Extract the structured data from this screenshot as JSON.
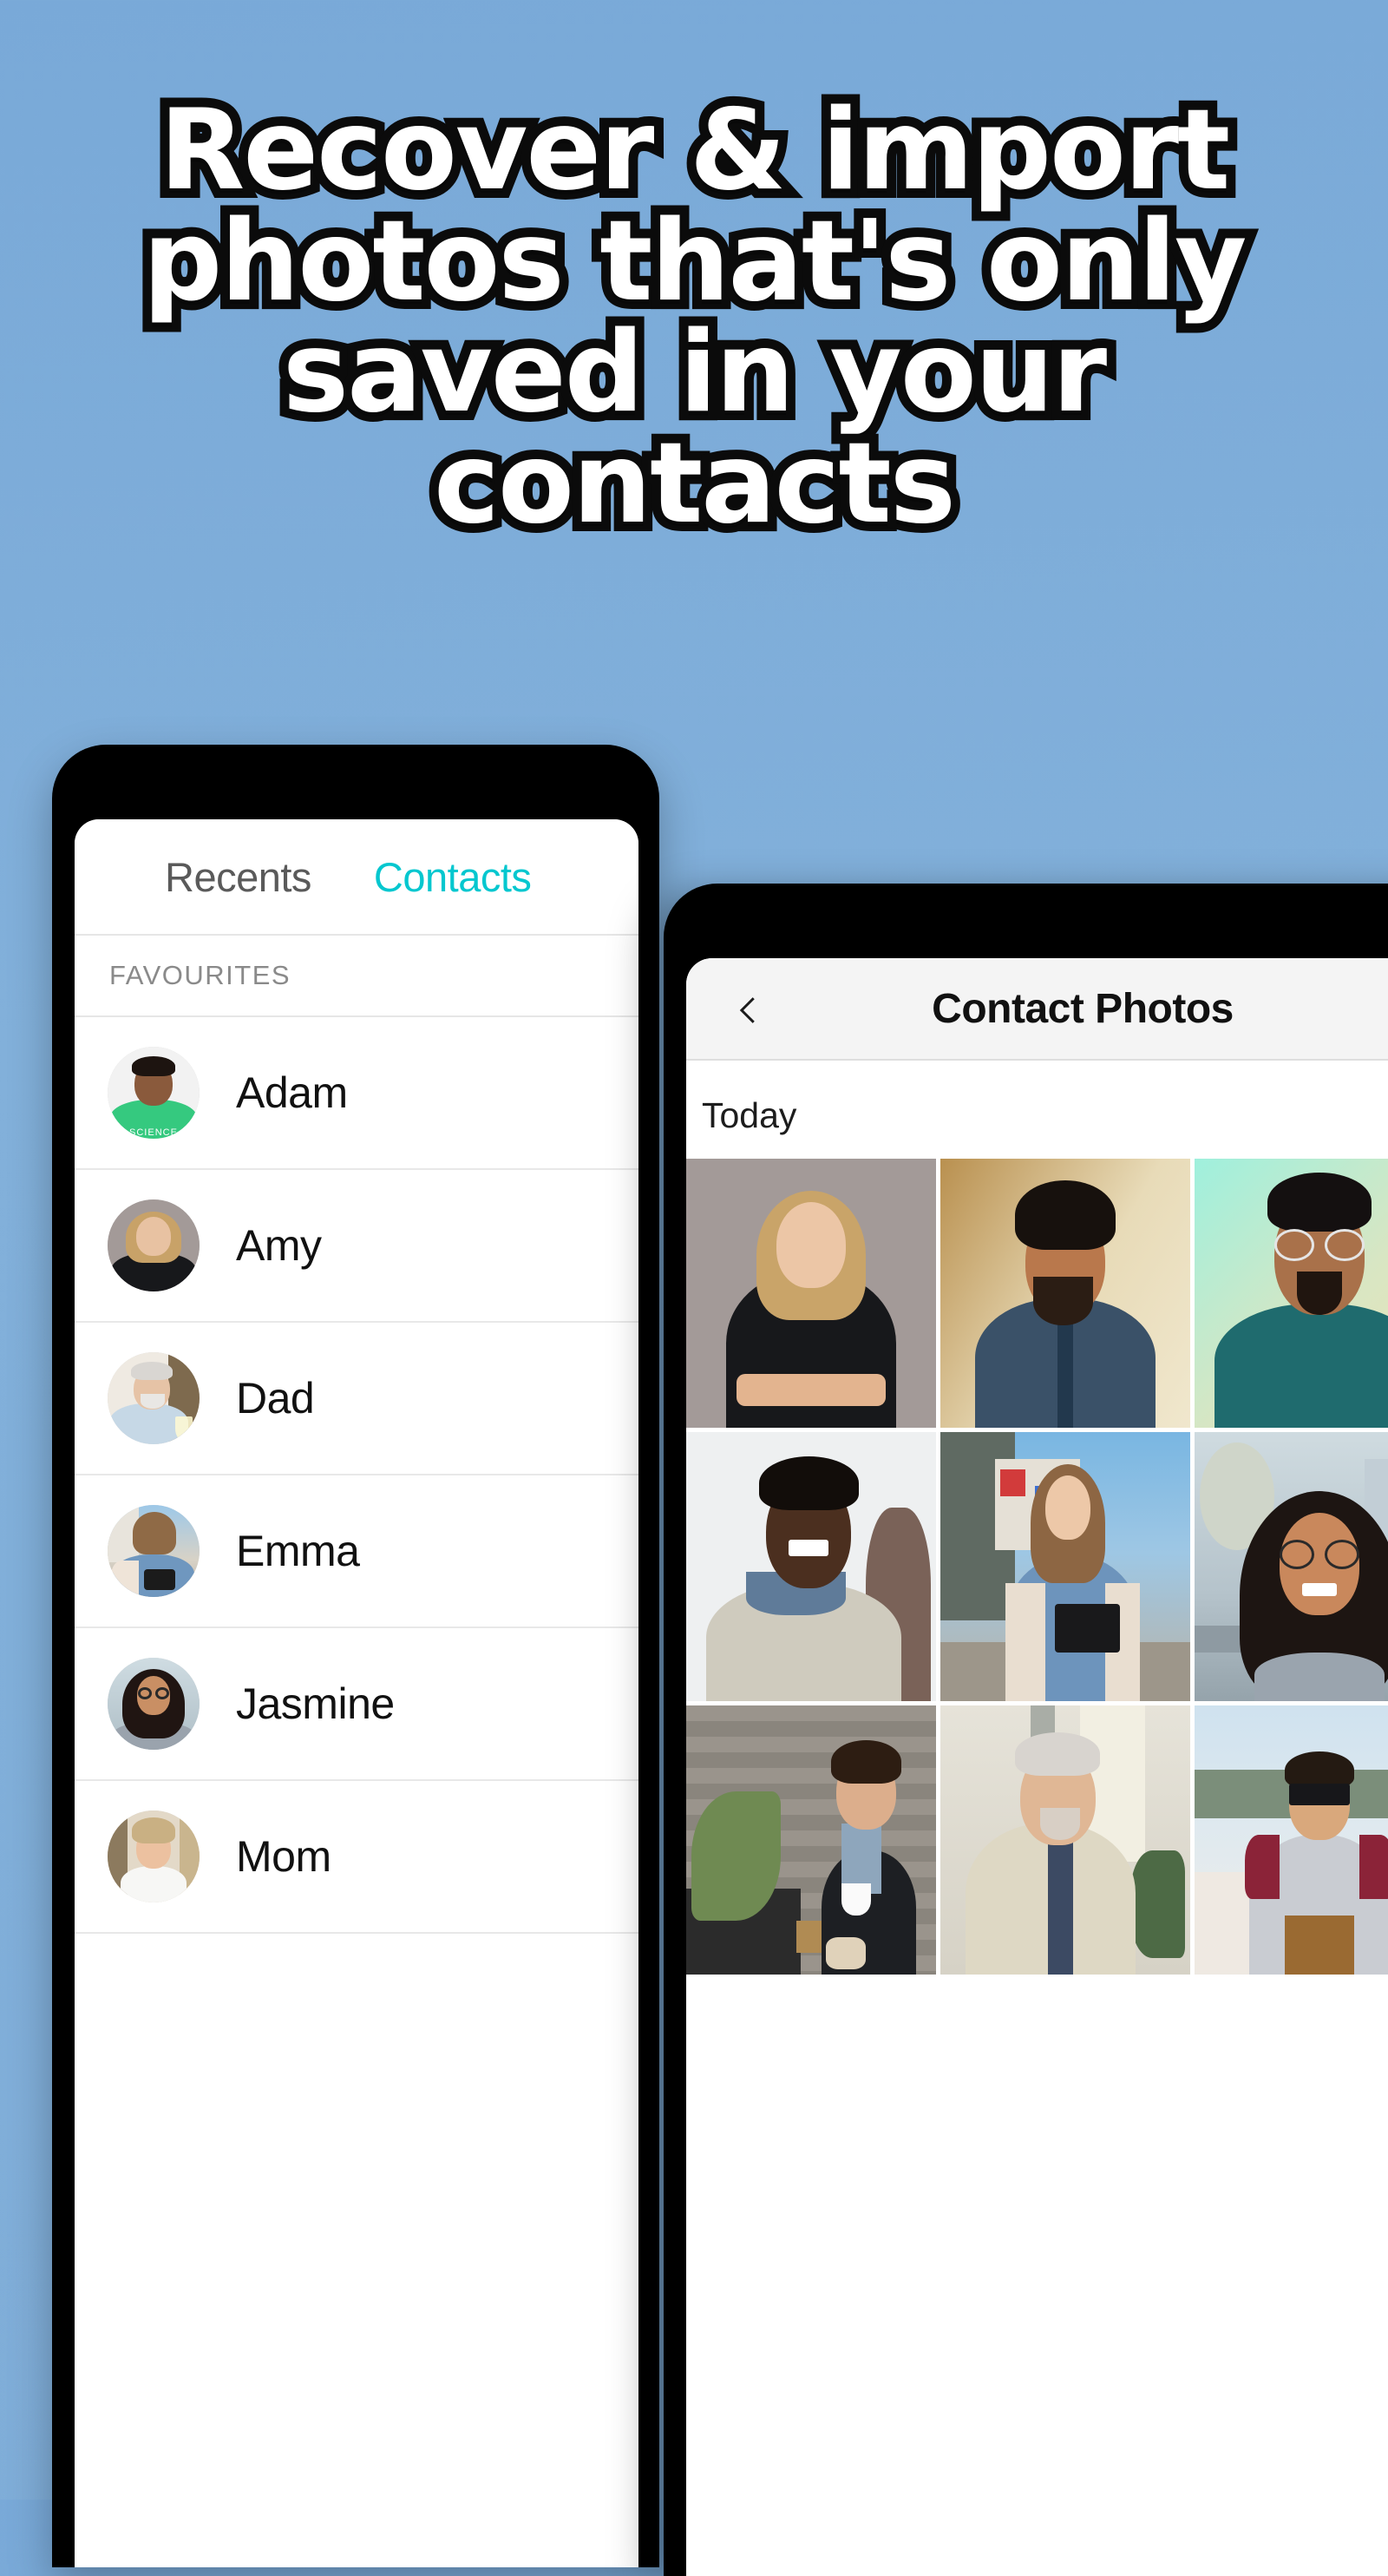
{
  "theme": {
    "background_top": "#79a9d8",
    "background_bottom": "#7fadd8",
    "accent_teal": "#05c7cf",
    "headline_fill": "#ffffff",
    "headline_outline": "#0b0b0b"
  },
  "headline": {
    "text": "Recover & import\nphotos that's only\nsaved in your\ncontacts"
  },
  "phone_contacts": {
    "tabs": [
      {
        "label": "Recents",
        "active": false
      },
      {
        "label": "Contacts",
        "active": true
      }
    ],
    "section_header": "FAVOURITES",
    "contacts": [
      {
        "name": "Adam",
        "avatar": "man-green-science-tshirt"
      },
      {
        "name": "Amy",
        "avatar": "blonde-woman-black-top"
      },
      {
        "name": "Dad",
        "avatar": "older-man-white-beard-blue-shirt"
      },
      {
        "name": "Emma",
        "avatar": "young-woman-denim-jacket-camera"
      },
      {
        "name": "Jasmine",
        "avatar": "woman-glasses-smiling-street"
      },
      {
        "name": "Mom",
        "avatar": "older-blonde-woman-white-collar"
      }
    ]
  },
  "phone_photos": {
    "back_icon": "chevron-left-icon",
    "title": "Contact Photos",
    "day_label": "Today",
    "photos": [
      {
        "caption": "blonde-woman-arms-crossed-black-top"
      },
      {
        "caption": "bearded-man-blue-shirt"
      },
      {
        "caption": "man-glasses-teal-tshirt"
      },
      {
        "caption": "smiling-man-beige-sweater"
      },
      {
        "caption": "woman-denim-jacket-camera"
      },
      {
        "caption": "woman-glasses-street"
      },
      {
        "caption": "man-coffee-wooden-wall"
      },
      {
        "caption": "older-man-tie-office"
      },
      {
        "caption": "man-sunglasses-raglan-shirt"
      }
    ]
  }
}
